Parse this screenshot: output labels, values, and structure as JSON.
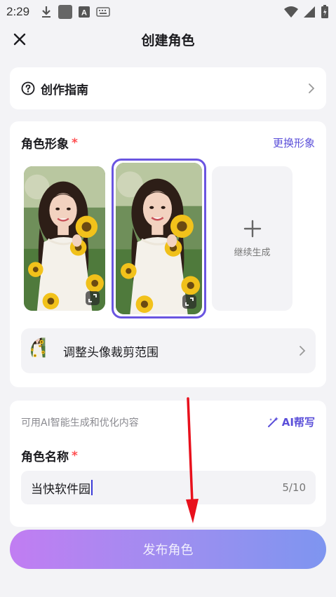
{
  "status_bar": {
    "time": "2:29"
  },
  "header": {
    "title": "创建角色"
  },
  "guide": {
    "label": "创作指南"
  },
  "avatar": {
    "title": "角色形象",
    "required_mark": "*",
    "change_label": "更换形象",
    "more_label": "继续生成",
    "crop_label": "调整头像裁剪范围",
    "selected_index": 2
  },
  "info": {
    "ai_hint": "可用AI智能生成和优化内容",
    "ai_button": "AI帮写",
    "name_title": "角色名称",
    "required_mark": "*",
    "name_value": "当快软件园",
    "name_count": "5/10"
  },
  "publish": {
    "label": "发布角色"
  },
  "colors": {
    "accent": "#5b4fd9",
    "required": "#ff4d4f",
    "selected_border": "#6a55e0",
    "annotation": "#e8101c"
  }
}
